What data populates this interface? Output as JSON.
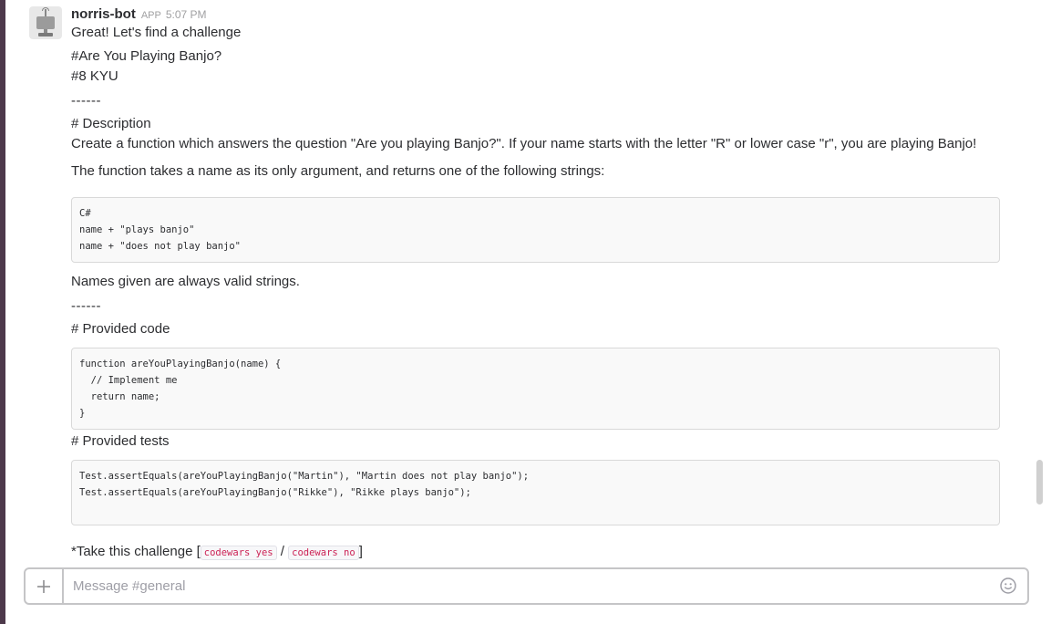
{
  "message": {
    "sender": "norris-bot",
    "badge": "APP",
    "time": "5:07 PM",
    "lines": {
      "greeting": "Great! Let's find a challenge",
      "title": "#Are You Playing Banjo?",
      "kyu": "#8 KYU",
      "sep1": "------",
      "desc_heading": "# Description",
      "desc1": "Create a function which answers the question \"Are you playing Banjo?\". If your name starts with the letter \"R\" or lower case \"r\", you are playing Banjo!",
      "desc2": "The function takes a name as its only argument, and returns one of the following strings:",
      "names_valid": "Names given are always valid strings.",
      "sep2": "------",
      "provided_code_heading": "# Provided code",
      "provided_tests_heading": "# Provided tests",
      "take_prefix": "*Take this challenge [",
      "slash": " / ",
      "take_suffix": "]"
    },
    "code_strings": [
      "C#",
      "name + \"plays banjo\"",
      "name + \"does not play banjo\""
    ],
    "code_provided": [
      "function areYouPlayingBanjo(name) {",
      "  // Implement me",
      "  return name;",
      "}"
    ],
    "code_tests": [
      "Test.assertEquals(areYouPlayingBanjo(\"Martin\"), \"Martin does not play banjo\");",
      "Test.assertEquals(areYouPlayingBanjo(\"Rikke\"), \"Rikke plays banjo\");"
    ],
    "command_yes": "codewars yes",
    "command_no": "codewars no"
  },
  "composer": {
    "placeholder": "Message #general",
    "plus_icon": "plus-icon",
    "emoji_icon": "emoji-icon"
  },
  "colors": {
    "sidebar": "#4d394b",
    "inline_code": "#cc2255"
  }
}
